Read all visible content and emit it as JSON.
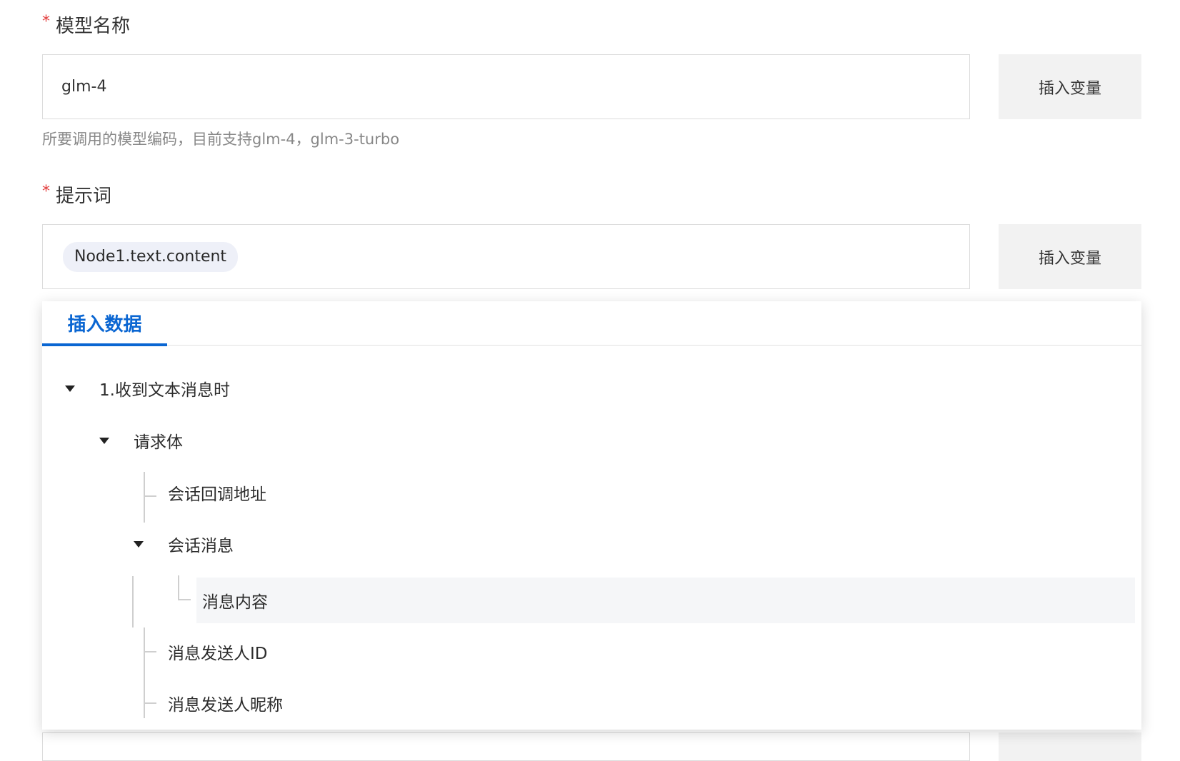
{
  "model_field": {
    "required_mark": "*",
    "label": "模型名称",
    "value": "glm-4",
    "insert_button": "插入变量",
    "hint": "所要调用的模型编码，目前支持glm-4，glm-3-turbo"
  },
  "prompt_field": {
    "required_mark": "*",
    "label": "提示词",
    "chip": "Node1.text.content",
    "insert_button": "插入变量"
  },
  "dropdown": {
    "tab": "插入数据",
    "tree": {
      "root": "1.收到文本消息时",
      "request_body": "请求体",
      "session_callback": "会话回调地址",
      "session_message": "会话消息",
      "message_content": "消息内容",
      "sender_id": "消息发送人ID",
      "sender_nickname": "消息发送人昵称"
    }
  },
  "colors": {
    "accent": "#0a66d2",
    "required": "#e23b3b"
  }
}
